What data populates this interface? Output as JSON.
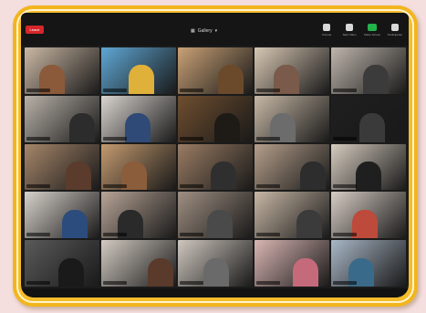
{
  "meeting": {
    "timestamp": "",
    "leave_label": "Leave",
    "view_label": "Gallery",
    "toolbar": [
      {
        "name": "unmute",
        "label": "Unmute",
        "icon": "mic-icon",
        "color": "#d8d8d8"
      },
      {
        "name": "start-video",
        "label": "Start Video",
        "icon": "camera-icon",
        "color": "#d8d8d8"
      },
      {
        "name": "share-screen",
        "label": "Share Screen",
        "icon": "share-screen-icon",
        "color": "#24b24b"
      },
      {
        "name": "participants",
        "label": "Participants",
        "icon": "participants-icon",
        "color": "#d8d8d8"
      }
    ]
  },
  "tiles": [
    {
      "bg": "#cbb8a4",
      "accent": "#8a5a3a"
    },
    {
      "bg": "#5fa7d4",
      "accent": "#e0b13a"
    },
    {
      "bg": "#c9a176",
      "accent": "#6b4a2c"
    },
    {
      "bg": "#d8c8b4",
      "accent": "#7a5a4a"
    },
    {
      "bg": "#bfb6ad",
      "accent": "#3b3b3b"
    },
    {
      "bg": "#b9b2a9",
      "accent": "#2c2c2c"
    },
    {
      "bg": "#d9d4cf",
      "accent": "#2f4a77"
    },
    {
      "bg": "#6f4e2f",
      "accent": "#1e1a16"
    },
    {
      "bg": "#c7b8a6",
      "accent": "#6c6c6c"
    },
    {
      "bg": "#1f1f1f",
      "accent": "#3a3a3a"
    },
    {
      "bg": "#a6866a",
      "accent": "#5b3b2b"
    },
    {
      "bg": "#c39a6f",
      "accent": "#8b5d3b"
    },
    {
      "bg": "#9a7c63",
      "accent": "#2f2f2f"
    },
    {
      "bg": "#b59f8b",
      "accent": "#2d2d2d"
    },
    {
      "bg": "#d6ccbf",
      "accent": "#1f1f1f"
    },
    {
      "bg": "#d8d2cb",
      "accent": "#2b4c7c"
    },
    {
      "bg": "#b7a496",
      "accent": "#2a2a2a"
    },
    {
      "bg": "#9f8f82",
      "accent": "#4a4a4a"
    },
    {
      "bg": "#c8b7a5",
      "accent": "#3b3b3b"
    },
    {
      "bg": "#d7cdc4",
      "accent": "#bd4a3a"
    },
    {
      "bg": "#5a5a5a",
      "accent": "#1a1a1a"
    },
    {
      "bg": "#d3cbc2",
      "accent": "#5a3b2b"
    },
    {
      "bg": "#cfc7bf",
      "accent": "#6a6a6a"
    },
    {
      "bg": "#d9b6b3",
      "accent": "#c56a7a"
    },
    {
      "bg": "#a9b7c6",
      "accent": "#3a6a8a"
    }
  ]
}
